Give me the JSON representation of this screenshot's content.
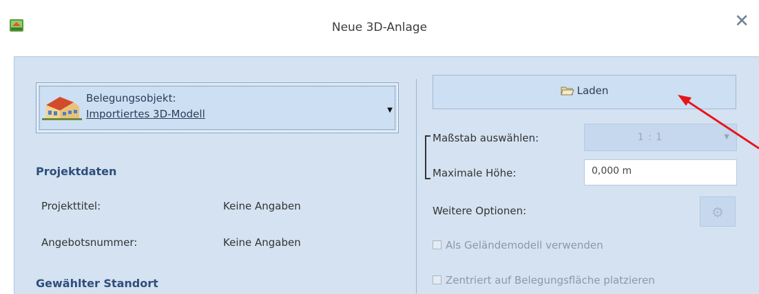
{
  "window": {
    "title": "Neue 3D-Anlage",
    "close_glyph": "✕",
    "app_icon": "app-icon"
  },
  "object_selector": {
    "label": "Belegungsobjekt:",
    "value": "Importiertes 3D-Modell",
    "icon": "house-icon",
    "dropdown_glyph": "▼"
  },
  "project_data": {
    "heading": "Projektdaten",
    "rows": [
      {
        "label": "Projekttitel:",
        "value": "Keine Angaben"
      },
      {
        "label": "Angebotsnummer:",
        "value": "Keine Angaben"
      }
    ]
  },
  "location": {
    "heading": "Gewählter Standort"
  },
  "load_button": {
    "label": "Laden",
    "icon": "folder-open-icon"
  },
  "scale": {
    "label": "Maßstab auswählen:",
    "value": "1 : 1",
    "dropdown_glyph": "▼"
  },
  "max_height": {
    "label": "Maximale Höhe:",
    "value": "0,000 m"
  },
  "more_options": {
    "label": "Weitere Optionen:",
    "icon": "gear-icon",
    "glyph": "⚙"
  },
  "checkboxes": [
    {
      "label": "Als Geländemodell verwenden",
      "checked": false,
      "enabled": false
    },
    {
      "label": "Zentriert auf Belegungsfläche platzieren",
      "checked": false,
      "enabled": false
    }
  ],
  "colors": {
    "panel_bg": "#d4e2f1",
    "heading": "#2e4e7a",
    "annotation_arrow": "#e8141b"
  }
}
